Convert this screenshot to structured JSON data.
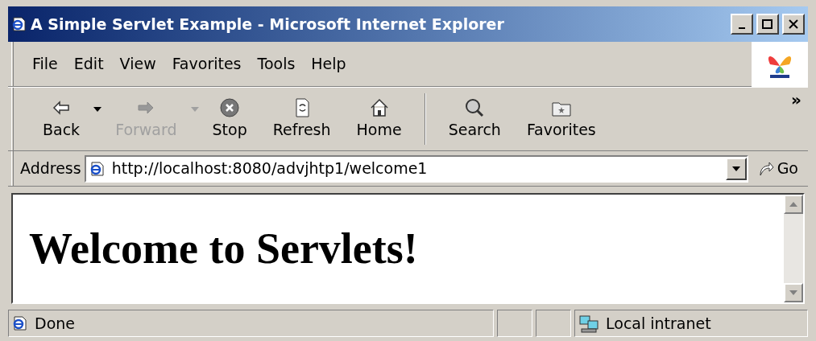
{
  "window": {
    "title": "A Simple Servlet Example - Microsoft Internet Explorer"
  },
  "menu": [
    "File",
    "Edit",
    "View",
    "Favorites",
    "Tools",
    "Help"
  ],
  "toolbar": [
    {
      "kind": "button",
      "label": "Back",
      "disabled": false,
      "dropdown": true
    },
    {
      "kind": "button",
      "label": "Forward",
      "disabled": true,
      "dropdown": true
    },
    {
      "kind": "button",
      "label": "Stop",
      "disabled": false,
      "dropdown": false
    },
    {
      "kind": "button",
      "label": "Refresh",
      "disabled": false,
      "dropdown": false
    },
    {
      "kind": "button",
      "label": "Home",
      "disabled": false,
      "dropdown": false
    },
    {
      "kind": "separator"
    },
    {
      "kind": "button",
      "label": "Search",
      "disabled": false,
      "dropdown": false
    },
    {
      "kind": "button",
      "label": "Favorites",
      "disabled": false,
      "dropdown": false
    }
  ],
  "toolbar_overflow": "»",
  "address": {
    "label": "Address",
    "value": "http://localhost:8080/advjhtp1/welcome1",
    "go": "Go"
  },
  "content": {
    "heading": "Welcome to Servlets!"
  },
  "status_bar": {
    "text": "Done",
    "zone": "Local intranet"
  }
}
